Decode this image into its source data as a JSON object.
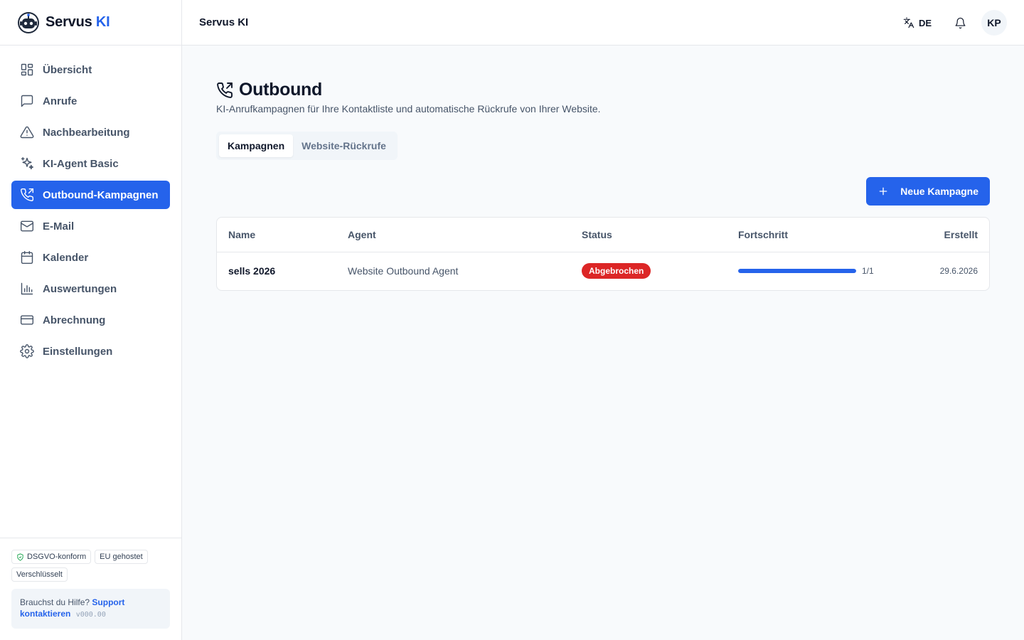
{
  "app": {
    "brand_primary": "Servus",
    "brand_accent": "KI",
    "header_title": "Servus KI"
  },
  "header": {
    "language": "DE",
    "avatar_initials": "KP"
  },
  "sidebar": {
    "items": [
      {
        "label": "Übersicht",
        "icon": "grid-icon"
      },
      {
        "label": "Anrufe",
        "icon": "message-icon"
      },
      {
        "label": "Nachbearbeitung",
        "icon": "warning-icon"
      },
      {
        "label": "KI-Agent Basic",
        "icon": "sparkles-icon"
      },
      {
        "label": "Outbound-Kampagnen",
        "icon": "phone-outgoing-icon",
        "active": true
      },
      {
        "label": "E-Mail",
        "icon": "mail-icon"
      },
      {
        "label": "Kalender",
        "icon": "calendar-icon"
      },
      {
        "label": "Auswertungen",
        "icon": "bar-chart-icon"
      },
      {
        "label": "Abrechnung",
        "icon": "credit-card-icon"
      },
      {
        "label": "Einstellungen",
        "icon": "gear-icon"
      }
    ],
    "badges": [
      "DSGVO-konform",
      "EU gehostet",
      "Verschlüsselt"
    ],
    "help_text": "Brauchst du Hilfe?",
    "help_link": "Support kontaktieren",
    "version": "v000.00"
  },
  "page": {
    "title": "Outbound",
    "subtitle": "KI-Anrufkampagnen für Ihre Kontaktliste und automatische Rückrufe von Ihrer Website.",
    "tabs": [
      {
        "label": "Kampagnen",
        "active": true
      },
      {
        "label": "Website-Rückrufe",
        "active": false
      }
    ],
    "new_button_label": "Neue Kampagne"
  },
  "table": {
    "columns": [
      "Name",
      "Agent",
      "Status",
      "Fortschritt",
      "Erstellt"
    ],
    "rows": [
      {
        "name": "sells 2026",
        "agent": "Website Outbound Agent",
        "status": "Abgebrochen",
        "progress_fraction": 1,
        "progress_text": "1/1",
        "created": "29.6.2026"
      }
    ]
  },
  "colors": {
    "accent": "#2563eb",
    "status_cancelled": "#dc2626",
    "shield_green": "#16a34a"
  }
}
